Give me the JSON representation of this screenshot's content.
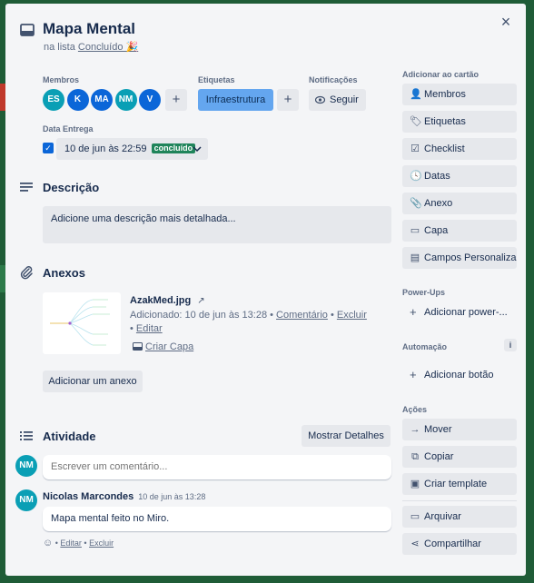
{
  "header": {
    "title": "Mapa Mental",
    "list_prefix": "na lista",
    "list_name": "Concluído 🎉",
    "close_symbol": "×"
  },
  "members": {
    "label": "Membros",
    "avatars": [
      {
        "initials": "ES",
        "color": "#0a9fb5"
      },
      {
        "initials": "K",
        "color": "#0b66d8"
      },
      {
        "initials": "MA",
        "color": "#0b66d8"
      },
      {
        "initials": "NM",
        "color": "#0a9fb5"
      },
      {
        "initials": "V",
        "color": "#0b66d8"
      }
    ],
    "add_symbol": "+"
  },
  "labels": {
    "label": "Etiquetas",
    "tag": "Infraestrutura",
    "tag_color": "#64a6ef",
    "add_symbol": "+"
  },
  "notifications": {
    "label": "Notificações",
    "button": "Seguir",
    "icon": "eye-icon"
  },
  "due_date": {
    "label": "Data Entrega",
    "value": "10 de jun às 22:59",
    "status": "concluído",
    "status_color": "#1f845a",
    "checked": true
  },
  "description": {
    "title": "Descrição",
    "placeholder": "Adicione uma descrição mais detalhada..."
  },
  "attachments": {
    "title": "Anexos",
    "file_name": "AzakMed.jpg",
    "added_text": "Adicionado: 10 de jun às 13:28 •",
    "comment_link": "Comentário",
    "delete_link": "Excluir",
    "edit_link": "Editar",
    "make_cover": "Criar Capa",
    "add_button": "Adicionar um anexo"
  },
  "activity": {
    "title": "Atividade",
    "details_button": "Mostrar Detalhes",
    "current_user_initials": "NM",
    "current_user_color": "#0a9fb5",
    "comment_placeholder": "Escrever um comentário...",
    "entry": {
      "author": "Nicolas Marcondes",
      "time": "10 de jun às 13:28",
      "text": "Mapa mental feito no Miro.",
      "edit": "Editar",
      "delete": "Excluir"
    }
  },
  "sidebar": {
    "add_to_card_label": "Adicionar ao cartão",
    "add_buttons": [
      {
        "label": "Membros",
        "icon": "person-icon",
        "glyph": "👤"
      },
      {
        "label": "Etiquetas",
        "icon": "tag-icon",
        "glyph": "🏷"
      },
      {
        "label": "Checklist",
        "icon": "checklist-icon",
        "glyph": "☑"
      },
      {
        "label": "Datas",
        "icon": "clock-icon",
        "glyph": "🕓"
      },
      {
        "label": "Anexo",
        "icon": "paperclip-icon",
        "glyph": "📎"
      },
      {
        "label": "Capa",
        "icon": "cover-icon",
        "glyph": "▭"
      },
      {
        "label": "Campos Personaliza...",
        "icon": "custom-fields-icon",
        "glyph": "▤"
      }
    ],
    "powerups_label": "Power-Ups",
    "add_powerup": "Adicionar power-...",
    "automation_label": "Automação",
    "add_button_label": "Adicionar botão",
    "actions_label": "Ações",
    "actions": [
      {
        "label": "Mover",
        "icon": "arrow-right-icon",
        "glyph": "→"
      },
      {
        "label": "Copiar",
        "icon": "copy-icon",
        "glyph": "⧉"
      },
      {
        "label": "Criar template",
        "icon": "template-icon",
        "glyph": "▣"
      },
      {
        "label": "Arquivar",
        "icon": "archive-icon",
        "glyph": "▭"
      },
      {
        "label": "Compartilhar",
        "icon": "share-icon",
        "glyph": "⋖"
      }
    ]
  }
}
